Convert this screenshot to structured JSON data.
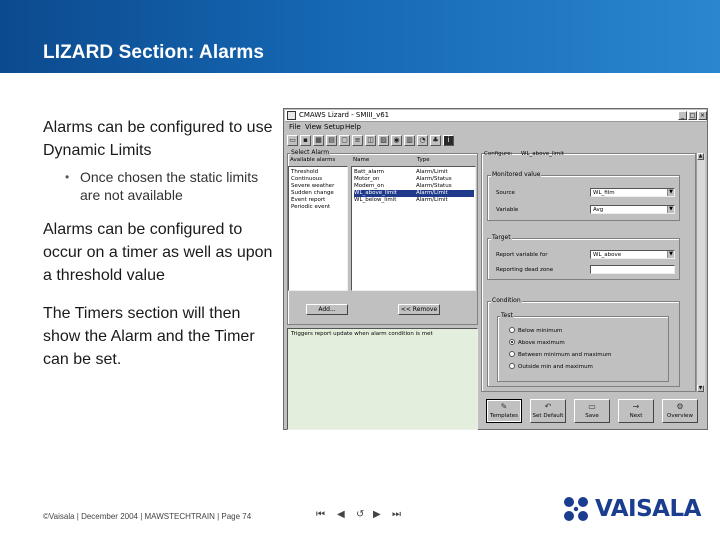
{
  "slide": {
    "title": "LIZARD Section: Alarms",
    "bullets": {
      "b1": "Alarms can be configured to use Dynamic Limits",
      "b1_sub_bullet": "•",
      "b1_sub": "Once chosen the static limits are not available",
      "b2": "Alarms can be configured to occur on a timer as well as upon a threshold value",
      "b3": "The Timers section will then show the Alarm and the Timer can be set."
    },
    "footer": "©Vaisala | December 2004 | MAWSTECHTRAIN | Page 74",
    "pager": [
      "first-icon",
      "prev-icon",
      "return-icon",
      "next-icon",
      "last-icon"
    ],
    "logo_text": "VAISALA",
    "brand_color": "#1a3d8f",
    "header_color": "#1567b3"
  },
  "window": {
    "title": "CMAWS Lizard - SMIII_v61",
    "title_buttons": [
      "_",
      "□",
      "×"
    ],
    "menu": [
      "File",
      "View",
      "Setup",
      "Help"
    ],
    "toolbar_icons": [
      "open-icon",
      "save-icon",
      "image-icon",
      "grid-icon",
      "window-icon",
      "settings-icon",
      "sensor-icon",
      "chart-icon",
      "scope-icon",
      "table-icon",
      "gauge-icon",
      "lizard-icon",
      "info-icon"
    ],
    "select_alarm": {
      "caption": "Select Alarm",
      "col_available": "Available alarms",
      "col_name": "Name",
      "col_type": "Type",
      "available": [
        "Threshold",
        "Continuous",
        "Severe weather",
        "Sudden change",
        "Event report",
        "Periodic event"
      ],
      "names": [
        "Batt_alarm",
        "Motor_on",
        "Modem_on",
        "WL_above_limit",
        "WL_below_limit"
      ],
      "types": [
        "Alarm/Limit",
        "Alarm/Status",
        "Alarm/Status",
        "Alarm/Limit",
        "Alarm/Limit"
      ],
      "selected_index": 3,
      "add_label": "Add...",
      "remove_label": "<< Remove",
      "description": "Triggers report update when alarm condition is met"
    },
    "configure": {
      "label": "Configure:",
      "name": "WL_above_limit",
      "monitored_caption": "Monitored value",
      "source_label": "Source",
      "source_value": "WL_film",
      "variable_label": "Variable",
      "variable_value": "Avg",
      "target_caption": "Target",
      "upper_label": "Report variable for",
      "upper_value": "WL_above",
      "lower_label": "Reporting dead zone",
      "lower_value": "",
      "condition_caption": "Condition",
      "test_caption": "Test",
      "tests": [
        "Below minimum",
        "Above maximum",
        "Between minimum and maximum",
        "Outside min and maximum"
      ],
      "selected_test": 1
    },
    "nav_buttons": [
      {
        "label": "Templates",
        "icon": "templates-icon",
        "glyph": "✎"
      },
      {
        "label": "Set Default",
        "icon": "undo-icon",
        "glyph": "↶"
      },
      {
        "label": "Save",
        "icon": "save-icon",
        "glyph": "▭"
      },
      {
        "label": "Next",
        "icon": "next-icon",
        "glyph": "→"
      },
      {
        "label": "Overview",
        "icon": "overview-icon",
        "glyph": "⚙"
      }
    ]
  }
}
